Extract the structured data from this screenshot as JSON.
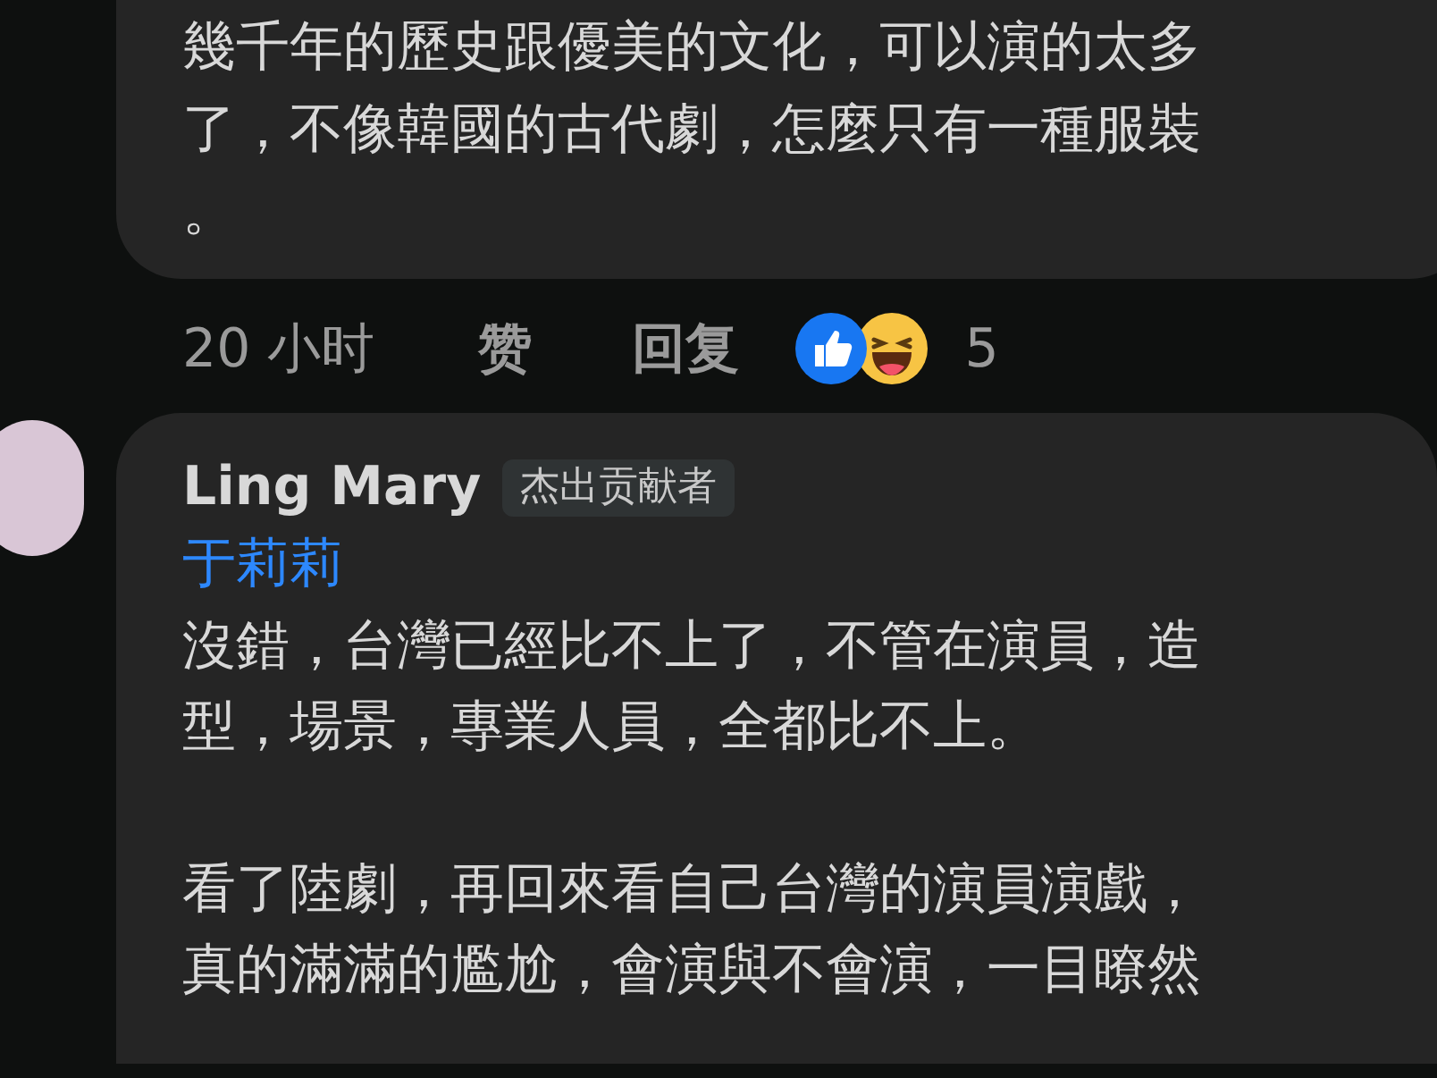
{
  "comments": [
    {
      "body_lines": [
        "幾千年的歷史跟優美的文化，可以演的太多",
        "了，不像韓國的古代劇，怎麼只有一種服裝",
        "。"
      ],
      "actions": {
        "time": "20 小时",
        "like": "赞",
        "reply": "回复",
        "reaction_count": "5"
      }
    },
    {
      "author": "Ling Mary",
      "badge": "杰出贡献者",
      "mention": "于莉莉",
      "paragraphs": [
        [
          "沒錯，台灣已經比不上了，不管在演員，造",
          "型，場景，專業人員，全都比不上。"
        ],
        [
          "看了陸劇，再回來看自己台灣的演員演戲，",
          "真的滿滿的尷尬，會演與不會演，一目瞭然"
        ]
      ]
    }
  ]
}
